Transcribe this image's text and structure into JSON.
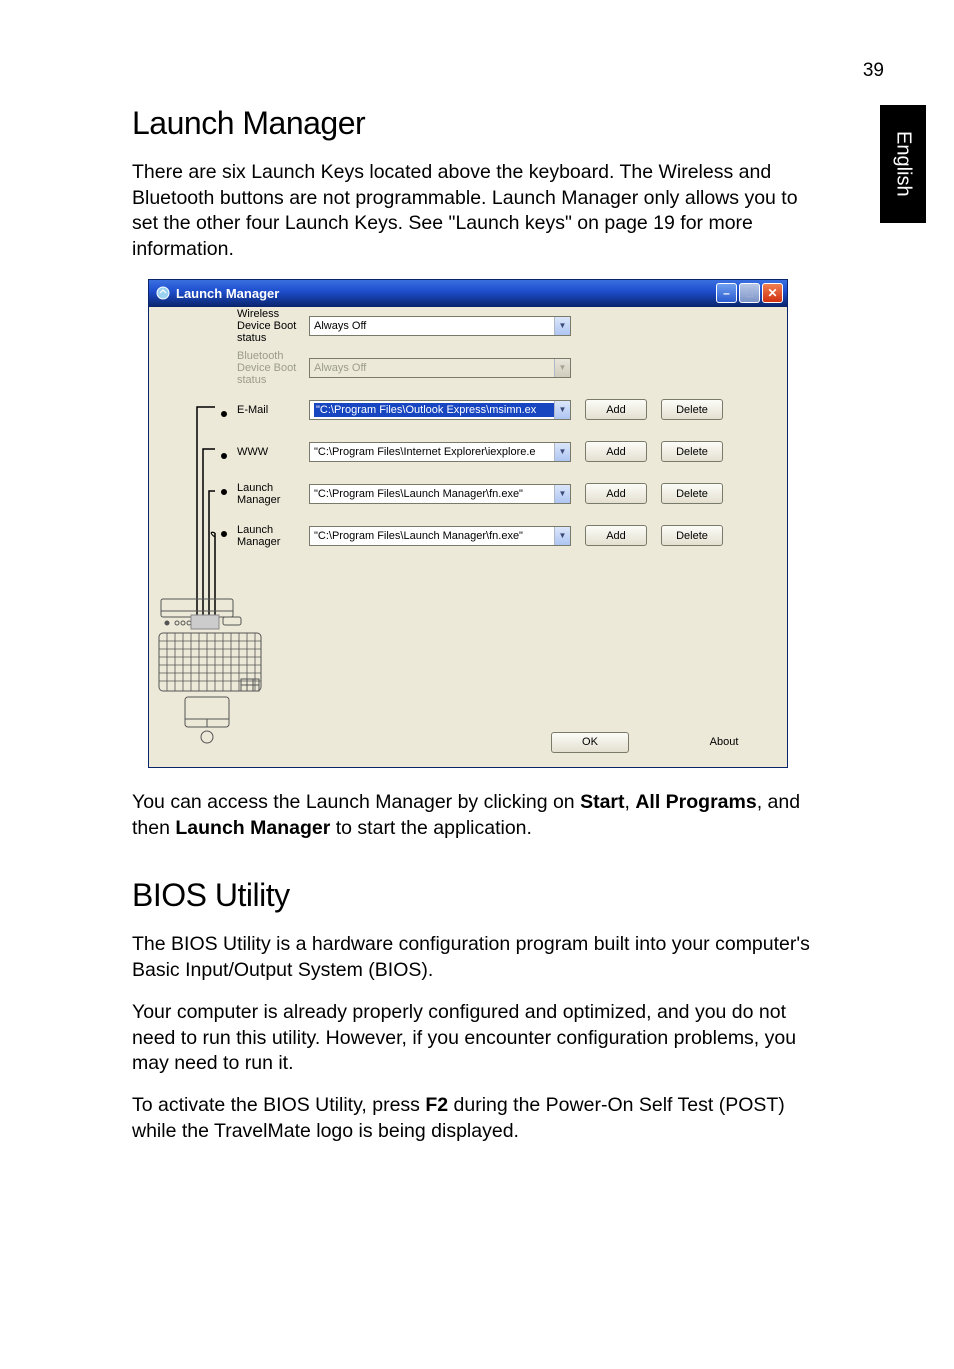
{
  "page_number": "39",
  "side_tab": "English",
  "section1": {
    "heading": "Launch Manager",
    "para1": "There are six Launch Keys located above the keyboard. The Wireless and Bluetooth buttons are not programmable. Launch Manager only allows you to set the other four Launch Keys. See \"Launch keys\" on page 19 for more information.",
    "para2_parts": {
      "a": "You can access the Launch Manager by clicking on ",
      "b": "Start",
      "c": ", ",
      "d": "All Programs",
      "e": ", and then ",
      "f": "Launch Manager",
      "g": " to start the application."
    }
  },
  "window": {
    "title": "Launch Manager",
    "rows": {
      "wireless": {
        "label": "Wireless Device Boot status",
        "value": "Always Off"
      },
      "bluetooth": {
        "label": "Bluetooth Device Boot status",
        "value": "Always Off"
      },
      "email": {
        "label": "E-Mail",
        "value": "\"C:\\Program Files\\Outlook Express\\msimn.ex"
      },
      "www": {
        "label": "WWW",
        "value": "\"C:\\Program Files\\Internet Explorer\\iexplore.e"
      },
      "lm1": {
        "label": "Launch Manager",
        "value": "\"C:\\Program Files\\Launch Manager\\fn.exe\""
      },
      "lm2": {
        "label": "Launch Manager",
        "value": "\"C:\\Program Files\\Launch Manager\\fn.exe\""
      }
    },
    "buttons": {
      "add": "Add",
      "delete": "Delete",
      "ok": "OK",
      "about": "About"
    }
  },
  "section2": {
    "heading": "BIOS Utility",
    "para1": "The BIOS Utility is a hardware configuration program built into your computer's Basic Input/Output System (BIOS).",
    "para2": "Your computer is already properly configured and optimized, and you do not need to run this utility. However, if you encounter configuration problems, you may need to run it.",
    "para3_parts": {
      "a": "To activate the BIOS Utility, press ",
      "b": "F2",
      "c": " during the Power-On Self Test (POST) while the TravelMate logo is being displayed."
    }
  }
}
